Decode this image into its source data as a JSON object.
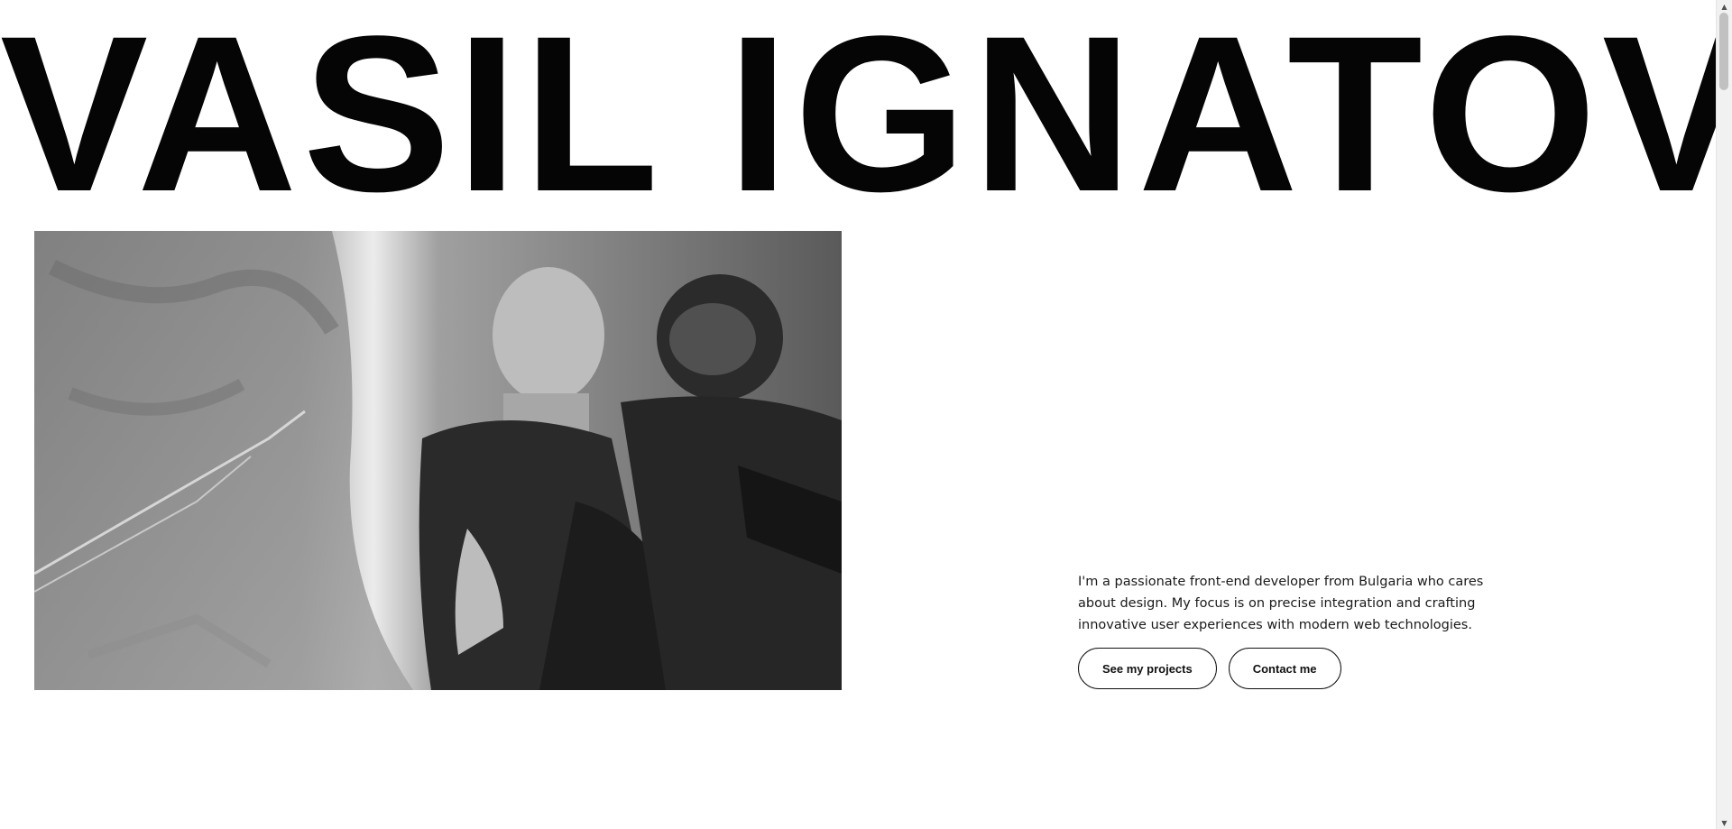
{
  "hero": {
    "title": "VASIL IGNATOV"
  },
  "photo": {
    "icon": "skydiving-photo"
  },
  "intro": {
    "text": "I'm a passionate front-end developer from Bulgaria who cares about design. My focus is on precise integration and crafting innovative user experiences with modern web technologies."
  },
  "actions": {
    "projects_label": "See my projects",
    "contact_label": "Contact me"
  },
  "scrollbar": {
    "up_icon": "chevron-up-icon",
    "down_icon": "chevron-down-icon",
    "position": 0
  },
  "colors": {
    "text": "#050505",
    "background": "#ffffff",
    "button_border": "#111111"
  }
}
